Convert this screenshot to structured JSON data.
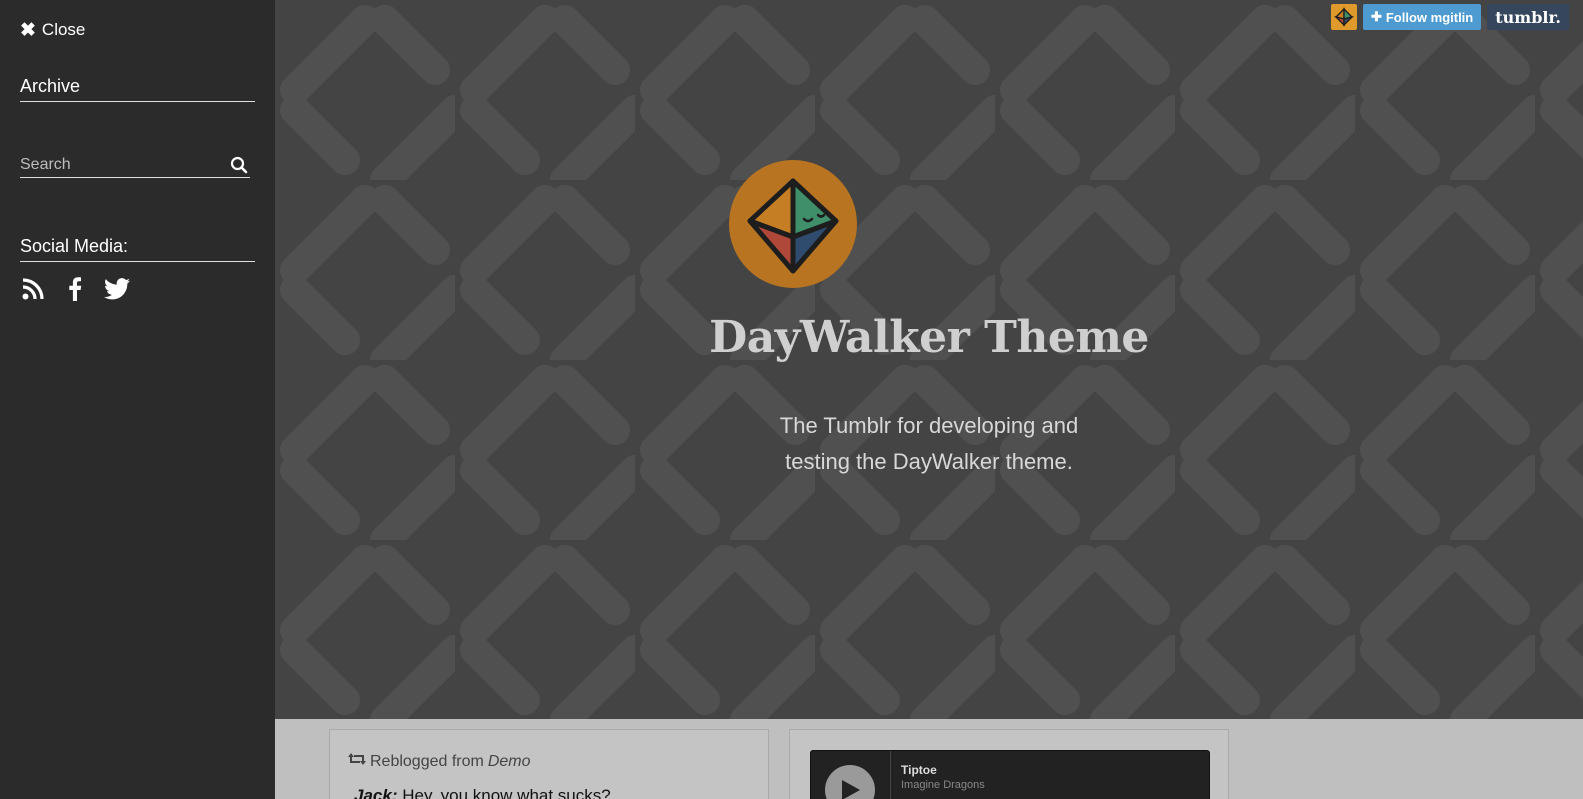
{
  "sidebar": {
    "close_label": "Close",
    "archive_label": "Archive",
    "search_placeholder": "Search",
    "social_title": "Social Media:",
    "social_icons": [
      "rss-icon",
      "facebook-icon",
      "twitter-icon"
    ]
  },
  "header": {
    "title": "DayWalker Theme",
    "description_line1": "The Tumblr for developing and",
    "description_line2": "testing the DayWalker theme."
  },
  "tumblr_bar": {
    "follow_label": "Follow mgitlin",
    "logo_text": "tumblr."
  },
  "posts": {
    "chat": {
      "reblog_prefix": "Reblogged from",
      "reblog_source": "Demo",
      "speaker": "Jack:",
      "line": " Hey, you know what sucks?"
    },
    "audio": {
      "track": "Tiptoe",
      "artist": "Imagine Dragons"
    }
  },
  "colors": {
    "sidebar_bg": "#2b2b2b",
    "header_bg": "#444444",
    "avatar_bg": "#b87420",
    "follow_button": "#4d9bd0",
    "tumblr_logo_bg": "#36465d"
  }
}
